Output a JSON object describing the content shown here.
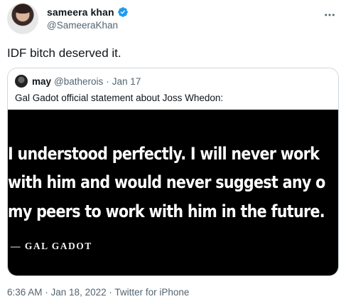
{
  "author": {
    "display_name": "sameera khan",
    "handle": "@SameeraKhan",
    "verified_icon": "verified-badge-icon",
    "avatar_icon": "avatar"
  },
  "tweet": {
    "text": "IDF bitch deserved it."
  },
  "quoted": {
    "display_name": "may",
    "handle": "@batherois",
    "separator": "·",
    "date": "Jan 17",
    "text": "Gal Gadot official statement about Joss Whedon:",
    "media": {
      "line1": "I understood perfectly. I will never work",
      "line2": "with him and would never suggest any o",
      "line3": "my peers to work with him in the future.",
      "attribution": "— GAL GADOT"
    }
  },
  "meta": {
    "time": "6:36 AM",
    "separator1": " · ",
    "date": "Jan 18, 2022",
    "separator2": " · ",
    "source": "Twitter for iPhone"
  },
  "colors": {
    "verified": "#1d9bf0",
    "secondary_text": "#536471",
    "border": "#cfd9de"
  }
}
